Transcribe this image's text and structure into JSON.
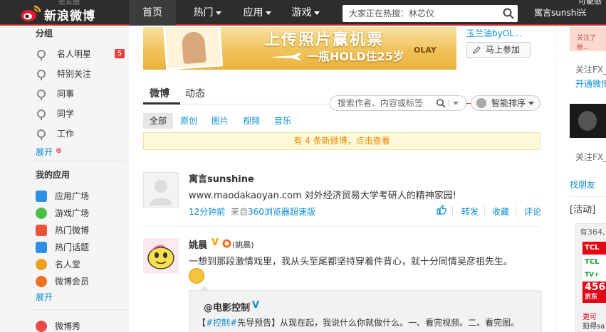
{
  "header": {
    "logo_text": "新浪微博",
    "ghost_text": "密友圈",
    "nav": [
      {
        "label": "首页"
      },
      {
        "label": "热门"
      },
      {
        "label": "应用"
      },
      {
        "label": "游戏"
      }
    ],
    "search_placeholder": "大家正在热搜：林芯仪",
    "user_name": "寓言sunshi..."
  },
  "sidebar": {
    "group_title": "分组",
    "groups": [
      {
        "label": "名人明星",
        "badge": "5"
      },
      {
        "label": "特别关注"
      },
      {
        "label": "同事"
      },
      {
        "label": "同学"
      },
      {
        "label": "工作"
      }
    ],
    "groups_expand": "展开",
    "apps_title": "我的应用",
    "apps": [
      {
        "label": "应用广场",
        "color": "#2d8fe8"
      },
      {
        "label": "游戏广场",
        "color": "#4bbf4b"
      },
      {
        "label": "热门微博",
        "color": "#e8553a"
      },
      {
        "label": "热门话题",
        "color": "#2d8fe8"
      },
      {
        "label": "名人堂",
        "color": "#f0a020"
      },
      {
        "label": "微博会员",
        "color": "#f07020"
      }
    ],
    "apps_expand": "展开",
    "bottom_item": {
      "label": "微博秀",
      "color": "#e84a4a"
    }
  },
  "banner": {
    "title": "上传照片赢机票",
    "subtitle": "一瓶HOLD住25岁",
    "brand": "OLAY",
    "side_title": "玉兰油byOL...",
    "join_label": "马上参加"
  },
  "feed": {
    "tabs": [
      {
        "label": "微博"
      },
      {
        "label": "动态"
      }
    ],
    "search_placeholder": "搜索作者、内容或标签",
    "sort_label": "智能排序",
    "filters": [
      {
        "label": "全部"
      },
      {
        "label": "原创"
      },
      {
        "label": "图片"
      },
      {
        "label": "视频"
      },
      {
        "label": "音乐"
      }
    ],
    "new_notice": "有 4 条新微博，点击查看",
    "posts": [
      {
        "author": "寓言sunshine",
        "text": "www.maodakaoyan.com 对外经济贸易大学考研人的精神家园!",
        "time": "12分钟前",
        "from_prefix": "来自",
        "source": "360浏览器超速版",
        "actions": [
          "转发",
          "收藏",
          "评论"
        ]
      },
      {
        "author": "姚晨",
        "alias": "(姚晨)",
        "text": "一想到那段激情戏里，我从头至尾都坚持穿着件背心，就十分同情吴彦祖先生。",
        "quote": {
          "author": "@电影控制",
          "tag": "#控制#",
          "text_prefix": "【",
          "text": "先导预告】从现在起，我说什么你就做什么。一、看完视频。二、看完图。"
        }
      }
    ]
  },
  "right": {
    "top_label": "可能感兴",
    "follow1": "关注FX_",
    "open1": "开通微博",
    "follow2": "关注FX_",
    "friends": "找朋友",
    "activity": "[活动]",
    "ad_count": "有364,",
    "ad_lines": [
      "TCL",
      "TCL",
      "TV+"
    ],
    "ad_price": "456",
    "ad_store": "京东",
    "ad_more": "更可",
    "ad_more2": "拍得sa"
  }
}
